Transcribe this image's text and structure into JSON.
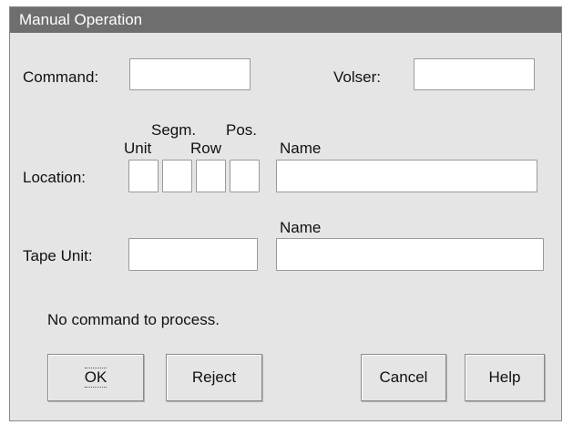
{
  "window": {
    "title": "Manual Operation"
  },
  "command": {
    "label": "Command:",
    "value": ""
  },
  "volser": {
    "label": "Volser:",
    "value": ""
  },
  "location": {
    "label": "Location:",
    "header_segm": "Segm.",
    "header_pos": "Pos.",
    "header_unit": "Unit",
    "header_row": "Row",
    "header_name": "Name",
    "unit_value": "",
    "segm_value": "",
    "row_value": "",
    "pos_value": "",
    "name_value": ""
  },
  "tape_unit": {
    "label": "Tape Unit:",
    "header_name": "Name",
    "value": "",
    "name_value": ""
  },
  "status": {
    "message": "No command to process."
  },
  "buttons": {
    "ok": "OK",
    "reject": "Reject",
    "cancel": "Cancel",
    "help": "Help"
  }
}
